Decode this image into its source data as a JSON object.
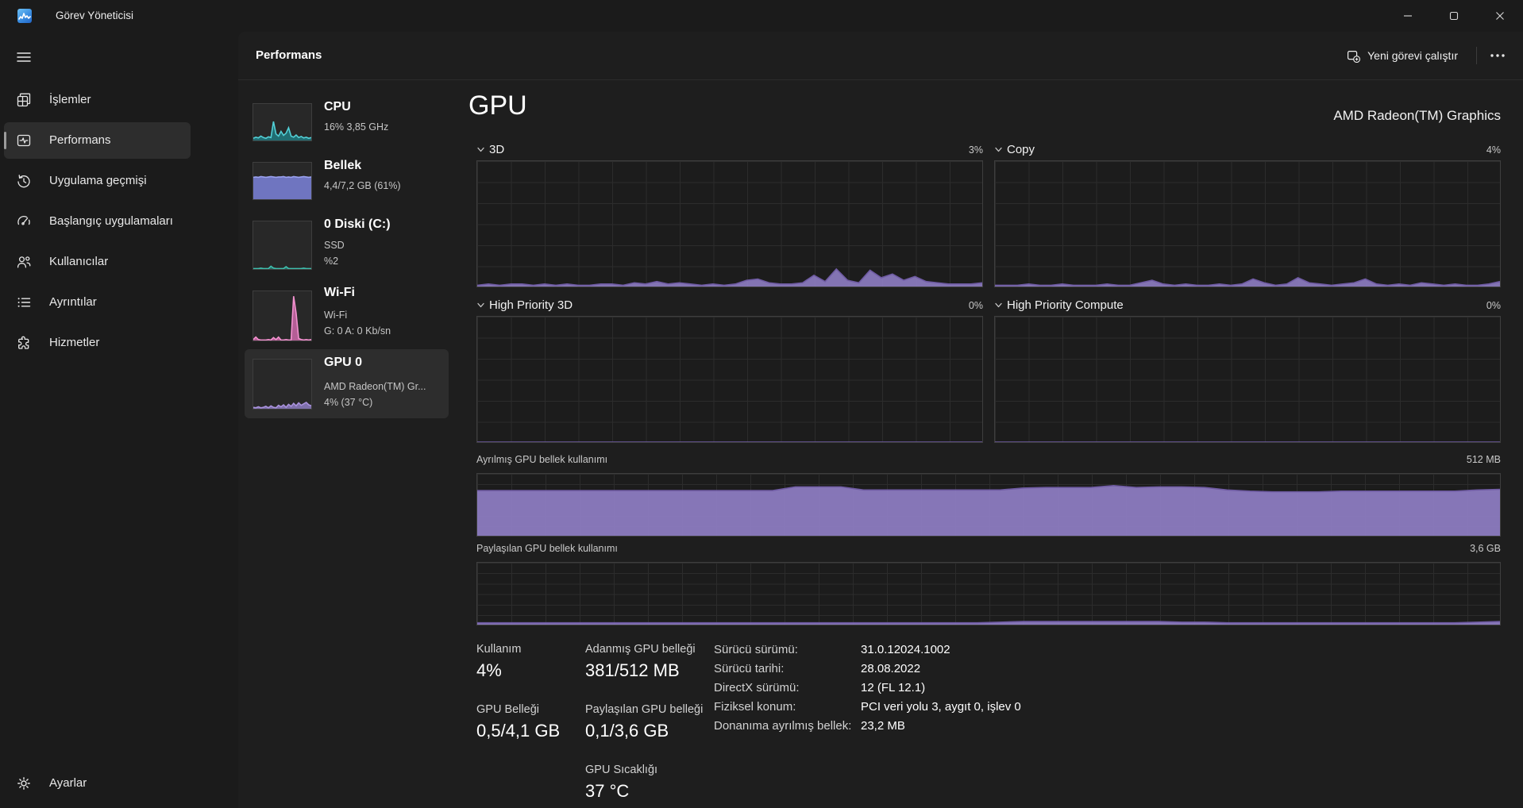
{
  "window": {
    "title": "Görev Yöneticisi"
  },
  "sidebar": {
    "items": [
      {
        "id": "islemler",
        "label": "İşlemler",
        "icon": "processes-icon",
        "selected": false
      },
      {
        "id": "performans",
        "label": "Performans",
        "icon": "performance-icon",
        "selected": true
      },
      {
        "id": "uygulama-gecmisi",
        "label": "Uygulama geçmişi",
        "icon": "history-icon",
        "selected": false
      },
      {
        "id": "baslangic-uygulamalari",
        "label": "Başlangıç uygulamaları",
        "icon": "startup-icon",
        "selected": false
      },
      {
        "id": "kullanicilar",
        "label": "Kullanıcılar",
        "icon": "users-icon",
        "selected": false
      },
      {
        "id": "ayrintilar",
        "label": "Ayrıntılar",
        "icon": "details-icon",
        "selected": false
      },
      {
        "id": "hizmetler",
        "label": "Hizmetler",
        "icon": "services-icon",
        "selected": false
      }
    ],
    "settings_label": "Ayarlar"
  },
  "header": {
    "title": "Performans",
    "run_task_label": "Yeni görevi çalıştır"
  },
  "perf_list": {
    "items": [
      {
        "id": "cpu",
        "title": "CPU",
        "lines": [
          "16% 3,85 GHz"
        ],
        "chart": "mini_cpu",
        "selected": false
      },
      {
        "id": "bellek",
        "title": "Bellek",
        "lines": [
          "4,4/7,2 GB (61%)"
        ],
        "chart": "mini_bellek",
        "selected": false
      },
      {
        "id": "disk",
        "title": "0 Diski (C:)",
        "lines": [
          "SSD",
          "%2"
        ],
        "chart": "mini_disk",
        "selected": false
      },
      {
        "id": "wifi",
        "title": "Wi-Fi",
        "lines": [
          "Wi-Fi",
          "G: 0 A: 0 Kb/sn"
        ],
        "chart": "mini_wifi",
        "selected": false
      },
      {
        "id": "gpu",
        "title": "GPU 0",
        "lines": [
          "AMD Radeon(TM) Gr...",
          "4% (37 °C)"
        ],
        "chart": "mini_gpu",
        "selected": true
      }
    ]
  },
  "gpu_page": {
    "title": "GPU",
    "device_name": "AMD Radeon(TM) Graphics",
    "engine_charts": [
      {
        "label": "3D",
        "value_label": "3%",
        "chart": "gpu_3d"
      },
      {
        "label": "Copy",
        "value_label": "4%",
        "chart": "gpu_copy"
      },
      {
        "label": "High Priority 3D",
        "value_label": "0%",
        "chart": "gpu_hp3d"
      },
      {
        "label": "High Priority Compute",
        "value_label": "0%",
        "chart": "gpu_hpc"
      }
    ],
    "memory_charts": [
      {
        "label": "Ayrılmış GPU bellek kullanımı",
        "scale_label": "512 MB",
        "chart": "gpu_mem_dedicated"
      },
      {
        "label": "Paylaşılan GPU bellek kullanımı",
        "scale_label": "3,6 GB",
        "chart": "gpu_mem_shared"
      }
    ],
    "stats": [
      {
        "label": "Kullanım",
        "value": "4%"
      },
      {
        "label": "GPU Belleği",
        "value": "0,5/4,1 GB"
      },
      {
        "label": "Adanmış GPU belleği",
        "value": "381/512 MB"
      },
      {
        "label": "Paylaşılan GPU belleği",
        "value": "0,1/3,6 GB"
      },
      {
        "label": "GPU Sıcaklığı",
        "value": "37 °C"
      }
    ],
    "driver_info": [
      {
        "label": "Sürücü sürümü:",
        "value": "31.0.12024.1002"
      },
      {
        "label": "Sürücü tarihi:",
        "value": "28.08.2022"
      },
      {
        "label": "DirectX sürümü:",
        "value": "12 (FL 12.1)"
      },
      {
        "label": "Fiziksel konum:",
        "value": "PCI veri yolu 3, aygıt 0, işlev 0"
      },
      {
        "label": "Donanıma ayrılmış bellek:",
        "value": "23,2 MB"
      }
    ]
  },
  "colors": {
    "gpu_purple_fill": "#8f7ec4",
    "gpu_purple_stroke": "#6f5ba3",
    "cpu_teal_fill": "#1e7e84",
    "cpu_teal_stroke": "#52cfd6",
    "memory_violet_fill": "#7b82da",
    "memory_violet_stroke": "#9aa1ef",
    "disk_green_fill": "#2a8d80",
    "disk_green_stroke": "#3fbfae",
    "wifi_pink_fill": "#d76bb2",
    "wifi_pink_stroke": "#f291cf",
    "selection_bg": "#2d2d2d",
    "panel_bg": "#1e1e1e",
    "window_bg": "#1b1b1b"
  },
  "chart_data": [
    {
      "id": "gpu_3d",
      "type": "area",
      "title": "3D",
      "current_label": "3%",
      "ylabel": "% utilization",
      "ylim": [
        0,
        100
      ],
      "grid": true,
      "stroke": "#6f5ba3",
      "fill": "#8f7ec4",
      "fill_opacity": 0.9,
      "values": [
        1,
        2,
        1,
        2,
        2,
        1,
        2,
        1,
        2,
        1,
        1,
        2,
        2,
        1,
        3,
        2,
        4,
        2,
        3,
        2,
        1,
        2,
        1,
        2,
        5,
        6,
        3,
        2,
        2,
        3,
        9,
        4,
        14,
        5,
        3,
        13,
        7,
        10,
        5,
        8,
        4,
        3,
        2,
        2,
        2,
        3
      ]
    },
    {
      "id": "gpu_copy",
      "type": "area",
      "title": "Copy",
      "current_label": "4%",
      "ylabel": "% utilization",
      "ylim": [
        0,
        100
      ],
      "grid": true,
      "stroke": "#6f5ba3",
      "fill": "#8f7ec4",
      "fill_opacity": 0.9,
      "values": [
        1,
        1,
        1,
        2,
        1,
        1,
        2,
        1,
        1,
        1,
        2,
        1,
        1,
        3,
        5,
        2,
        1,
        2,
        1,
        1,
        2,
        1,
        2,
        6,
        3,
        1,
        2,
        7,
        3,
        2,
        1,
        2,
        3,
        6,
        2,
        1,
        2,
        1,
        3,
        2,
        1,
        2,
        1,
        1,
        2,
        4
      ]
    },
    {
      "id": "gpu_hp3d",
      "type": "area",
      "title": "High Priority 3D",
      "current_label": "0%",
      "ylabel": "% utilization",
      "ylim": [
        0,
        100
      ],
      "grid": true,
      "stroke": "#6f5ba3",
      "fill": "#8f7ec4",
      "fill_opacity": 0.9,
      "values": [
        0,
        0,
        0,
        0,
        0,
        0,
        0,
        0,
        0,
        0
      ]
    },
    {
      "id": "gpu_hpc",
      "type": "area",
      "title": "High Priority Compute",
      "current_label": "0%",
      "ylabel": "% utilization",
      "ylim": [
        0,
        100
      ],
      "grid": true,
      "stroke": "#6f5ba3",
      "fill": "#8f7ec4",
      "fill_opacity": 0.9,
      "values": [
        0,
        0,
        0,
        0,
        0,
        0,
        0,
        0,
        0,
        0
      ]
    },
    {
      "id": "gpu_mem_dedicated",
      "type": "area",
      "title": "Ayrılmış GPU bellek kullanımı",
      "ymax_label": "512 MB",
      "current": "381 MB",
      "ylim": [
        0,
        100
      ],
      "grid": true,
      "stroke": "#6f5ba3",
      "fill": "#8f7ec4",
      "fill_opacity": 0.92,
      "values": [
        73,
        73,
        73,
        73,
        73,
        73,
        73,
        73,
        73,
        73,
        73,
        73,
        73,
        73,
        79,
        79,
        79,
        74,
        74,
        74,
        74,
        74,
        74,
        74,
        77,
        78,
        78,
        78,
        81,
        78,
        79,
        79,
        78,
        74,
        72,
        71,
        71,
        71,
        72,
        72,
        72,
        72,
        72,
        72,
        74,
        75
      ]
    },
    {
      "id": "gpu_mem_shared",
      "type": "area",
      "title": "Paylaşılan GPU bellek kullanımı",
      "ymax_label": "3,6 GB",
      "current": "0,1 GB",
      "ylim": [
        0,
        100
      ],
      "grid": true,
      "stroke": "#6f5ba3",
      "fill": "#8f7ec4",
      "fill_opacity": 0.92,
      "values": [
        3,
        3,
        3,
        3,
        3,
        3,
        3,
        3,
        3,
        3,
        3,
        3,
        3,
        3,
        3,
        3,
        3,
        3,
        3,
        3,
        3,
        3,
        3,
        4,
        5,
        5,
        5,
        5,
        5,
        5,
        5,
        4,
        4,
        3,
        3,
        3,
        3,
        3,
        3,
        3,
        3,
        3,
        3,
        3,
        4,
        5
      ]
    },
    {
      "id": "mini_cpu",
      "type": "area",
      "title": "CPU mini graph",
      "ylim": [
        0,
        100
      ],
      "stroke": "#52cfd6",
      "fill": "#1e7e84",
      "fill_opacity": 0.8,
      "values": [
        6,
        9,
        7,
        12,
        8,
        6,
        10,
        8,
        52,
        18,
        12,
        25,
        14,
        20,
        35,
        12,
        9,
        15,
        8,
        11,
        7,
        9,
        6,
        8
      ]
    },
    {
      "id": "mini_bellek",
      "type": "area",
      "title": "Bellek mini graph",
      "ylim": [
        0,
        100
      ],
      "stroke": "#9aa1ef",
      "fill": "#7b82da",
      "fill_opacity": 0.85,
      "values": [
        60,
        61,
        60,
        62,
        61,
        60,
        61,
        62,
        61,
        60,
        61,
        61,
        62,
        60,
        61,
        60,
        62,
        61,
        60,
        61,
        62,
        61,
        60,
        61
      ]
    },
    {
      "id": "mini_disk",
      "type": "area",
      "title": "Disk mini graph",
      "ylim": [
        0,
        100
      ],
      "stroke": "#3fbfae",
      "fill": "#2a8d80",
      "fill_opacity": 0.7,
      "values": [
        1,
        1,
        1,
        2,
        1,
        1,
        1,
        6,
        2,
        1,
        1,
        1,
        1,
        5,
        1,
        1,
        1,
        1,
        1,
        1,
        2,
        1,
        1,
        1
      ]
    },
    {
      "id": "mini_wifi",
      "type": "area",
      "title": "Wi-Fi mini graph",
      "ylim": [
        0,
        100
      ],
      "stroke": "#f291cf",
      "fill": "#d76bb2",
      "fill_opacity": 0.8,
      "values": [
        2,
        7,
        2,
        1,
        1,
        1,
        2,
        1,
        6,
        2,
        7,
        1,
        1,
        2,
        1,
        1,
        90,
        55,
        4,
        2,
        1,
        2,
        1,
        2
      ]
    },
    {
      "id": "mini_gpu",
      "type": "area",
      "title": "GPU mini graph",
      "ylim": [
        0,
        100
      ],
      "stroke": "#a991dc",
      "fill": "#8d7cc1",
      "fill_opacity": 0.85,
      "values": [
        3,
        2,
        4,
        2,
        3,
        5,
        2,
        6,
        3,
        2,
        7,
        4,
        8,
        3,
        9,
        5,
        11,
        6,
        12,
        7,
        10,
        13,
        8,
        6
      ]
    }
  ]
}
